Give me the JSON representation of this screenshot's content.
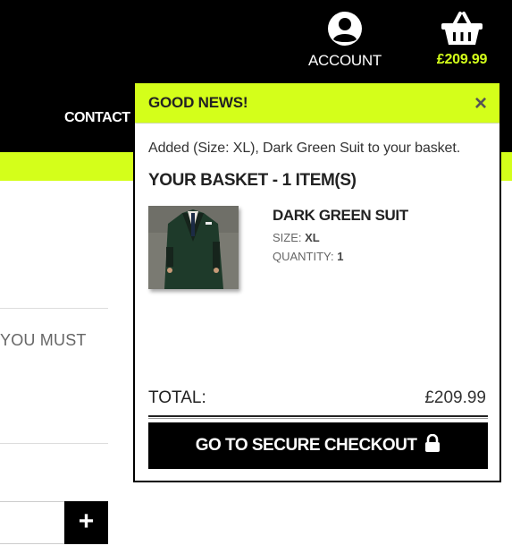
{
  "header": {
    "account_label": "ACCOUNT",
    "account_icon": "user-circle-icon",
    "basket_total": "£209.99",
    "basket_icon": "shopping-basket-icon",
    "nav_contact": "CONTACT"
  },
  "page": {
    "partial_text": "YOU MUST",
    "plus_label": "+"
  },
  "popup": {
    "title": "GOOD NEWS!",
    "close_label": "×",
    "added_message": "Added (Size: XL), Dark Green Suit to your basket.",
    "basket_heading": "YOUR BASKET - 1 ITEM(S)",
    "item": {
      "name": "DARK GREEN SUIT",
      "size_label": "SIZE:",
      "size_value": "XL",
      "quantity_label": "QUANTITY:",
      "quantity_value": "1",
      "image_icon": "product-photo"
    },
    "total_label": "TOTAL:",
    "total_value": "£209.99",
    "checkout_label": "GO TO SECURE CHECKOUT",
    "checkout_icon": "lock-icon"
  },
  "colors": {
    "accent": "#d4ff1a",
    "header_bg": "#000000",
    "button_bg": "#000000"
  }
}
